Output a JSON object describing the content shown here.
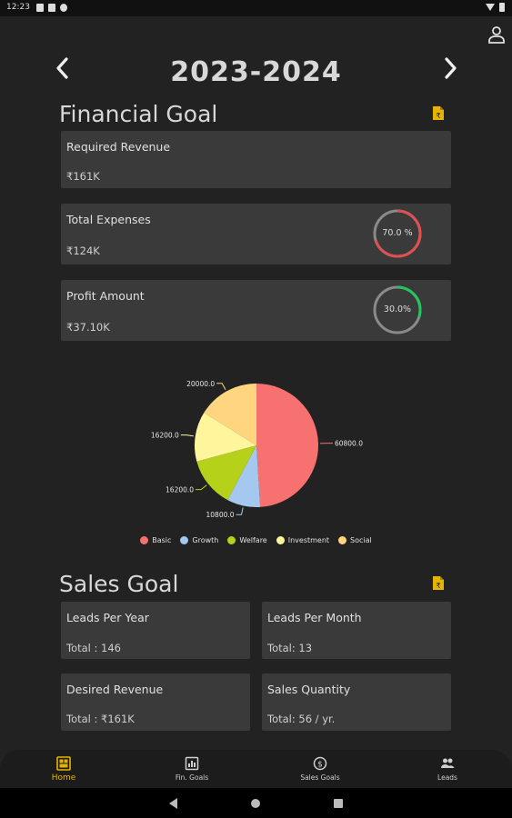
{
  "status_bar": {
    "time": "12:23"
  },
  "header": {
    "year": "2023-2024"
  },
  "financial_goal": {
    "title": "Financial Goal",
    "cards": [
      {
        "label": "Required Revenue",
        "value": "₹161K"
      },
      {
        "label": "Total Expenses",
        "value": "₹124K",
        "ring_text": "70.0 %",
        "ring_percent": 70.0,
        "ring_color": "#e05050"
      },
      {
        "label": "Profit Amount",
        "value": "₹37.10K",
        "ring_text": "30.0%",
        "ring_percent": 30.0,
        "ring_color": "#22c55e"
      }
    ]
  },
  "chart_data": {
    "type": "pie",
    "slices": [
      {
        "name": "Basic",
        "value": 60800.0,
        "label": "60800.0",
        "color": "#f87171"
      },
      {
        "name": "Growth",
        "value": 10800.0,
        "label": "10800.0",
        "color": "#a5c8f0"
      },
      {
        "name": "Welfare",
        "value": 16200.0,
        "label": "16200.0",
        "color": "#b5d11a"
      },
      {
        "name": "Investment",
        "value": 16200.0,
        "label": "16200.0",
        "color": "#fff59d"
      },
      {
        "name": "Social",
        "value": 20000.0,
        "label": "20000.0",
        "color": "#ffd580"
      }
    ],
    "legend_position": "bottom"
  },
  "sales_goal": {
    "title": "Sales Goal",
    "cards": [
      {
        "label": "Leads Per Year",
        "value": "Total : 146"
      },
      {
        "label": "Leads Per Month",
        "value": "Total: 13"
      },
      {
        "label": "Desired Revenue",
        "value": "Total : ₹161K"
      },
      {
        "label": "Sales Quantity",
        "value": "Total: 56 / yr."
      }
    ]
  },
  "bottom_nav": {
    "tabs": [
      {
        "label": "Home",
        "icon": "home-dashboard-icon",
        "active": true
      },
      {
        "label": "Fin. Goals",
        "icon": "finance-goals-icon",
        "active": false
      },
      {
        "label": "Sales Goals",
        "icon": "dollar-circle-icon",
        "active": false
      },
      {
        "label": "Leads",
        "icon": "people-icon",
        "active": false
      }
    ]
  },
  "colors": {
    "accent": "#e6b400",
    "card_bg": "#3a3a3a",
    "background": "#222222"
  }
}
